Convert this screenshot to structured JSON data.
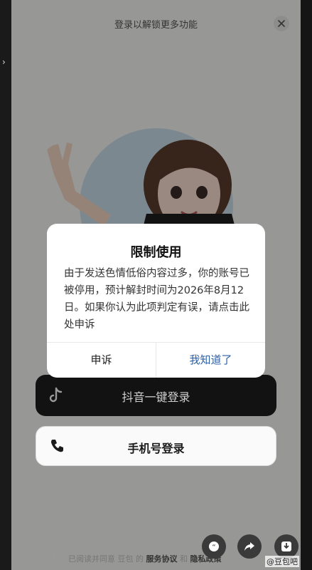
{
  "header": {
    "title": "登录以解锁更多功能"
  },
  "buttons": {
    "douyin_login": "抖音一键登录",
    "phone_login": "手机号登录"
  },
  "agreement": {
    "prefix": "已阅读并同意 豆包 的",
    "service": "服务协议",
    "and": "和",
    "privacy": "隐私政策"
  },
  "dialog": {
    "title": "限制使用",
    "message": "由于发送色情低俗内容过多，你的账号已被停用，预计解封时间为2026年8月12日。如果你认为此项判定有误，请点击此处申诉",
    "appeal_label": "申诉",
    "ok_label": "我知道了"
  },
  "watermark": "@豆包吧",
  "colors": {
    "accent_blue": "#2b5fa8",
    "dark_button": "#121212"
  },
  "icons": {
    "close": "close-icon",
    "douyin": "tiktok-icon",
    "phone": "phone-icon",
    "quote": "quote-icon",
    "share": "share-icon",
    "download": "download-icon"
  }
}
